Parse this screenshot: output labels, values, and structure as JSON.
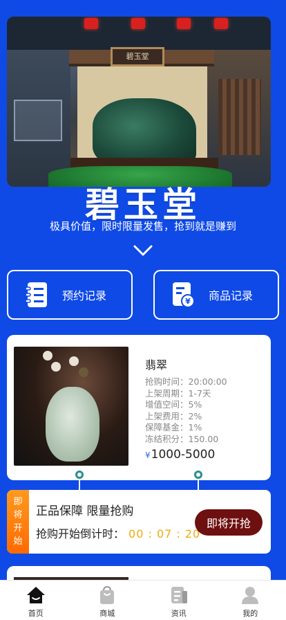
{
  "hero": {
    "sign_text": "碧玉堂",
    "title": "碧玉堂",
    "subtitle": "极具价值，限时限量发售，抢到就是赚到"
  },
  "nav": {
    "booking_label": "预约记录",
    "goods_label": "商品记录"
  },
  "product": {
    "name": "翡翠",
    "rows": [
      "抢购时间：20:00:00",
      "上架周期：1-7天",
      "增值空间：5%",
      "上架费用：2%",
      "保障基金：1%",
      "冻结积分：150.00"
    ],
    "currency_symbol": "¥",
    "price": "1000-5000"
  },
  "timer": {
    "side_chars": [
      "即",
      "将",
      "开",
      "始"
    ],
    "line1": "正品保障 限量抢购",
    "countdown_label": "抢购开始倒计时：",
    "countdown": "00 : 07 : 20",
    "button_label": "即将开抢"
  },
  "tabbar": {
    "items": [
      {
        "label": "首页",
        "icon": "home-icon",
        "active": true
      },
      {
        "label": "商城",
        "icon": "shopping-bag-icon",
        "active": false
      },
      {
        "label": "资讯",
        "icon": "news-icon",
        "active": false
      },
      {
        "label": "我的",
        "icon": "user-icon",
        "active": false
      }
    ]
  },
  "colors": {
    "background": "#0f4ae6",
    "countdown": "#f0a90e",
    "button": "#6e1010",
    "side_badge": "#ff7a10"
  }
}
